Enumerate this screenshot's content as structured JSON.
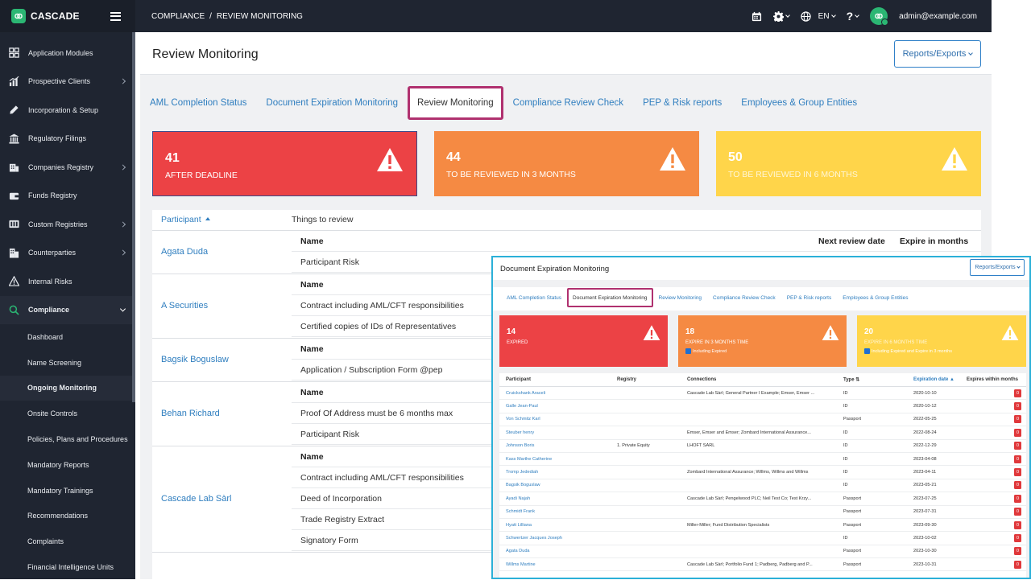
{
  "app": {
    "name": "CASCADE"
  },
  "topbar": {
    "breadcrumb": [
      "COMPLIANCE",
      "/",
      "REVIEW MONITORING"
    ],
    "language": "EN",
    "user": "admin@example.com"
  },
  "sidebar": {
    "items": [
      {
        "label": "Application Modules",
        "icon": "grid-icon",
        "chevron": false
      },
      {
        "label": "Prospective Clients",
        "icon": "chart-icon",
        "chevron": true
      },
      {
        "label": "Incorporation & Setup",
        "icon": "pen-icon",
        "chevron": false
      },
      {
        "label": "Regulatory Filings",
        "icon": "bank-icon",
        "chevron": false
      },
      {
        "label": "Companies Registry",
        "icon": "building-icon",
        "chevron": true
      },
      {
        "label": "Funds Registry",
        "icon": "wallet-icon",
        "chevron": false
      },
      {
        "label": "Custom Registries",
        "icon": "columns-icon",
        "chevron": true
      },
      {
        "label": "Counterparties",
        "icon": "office-icon",
        "chevron": true
      },
      {
        "label": "Internal Risks",
        "icon": "warning-icon",
        "chevron": false
      },
      {
        "label": "Compliance",
        "icon": "search-icon",
        "chevron": true,
        "active": true
      }
    ],
    "subitems": [
      {
        "label": "Dashboard"
      },
      {
        "label": "Name Screening"
      },
      {
        "label": "Ongoing Monitoring",
        "active": true
      },
      {
        "label": "Onsite Controls"
      },
      {
        "label": "Policies, Plans and Procedures"
      },
      {
        "label": "Mandatory Reports"
      },
      {
        "label": "Mandatory Trainings"
      },
      {
        "label": "Recommendations"
      },
      {
        "label": "Complaints"
      },
      {
        "label": "Financial Intelligence Units"
      }
    ]
  },
  "page": {
    "title": "Review Monitoring",
    "export_label": "Reports/Exports",
    "tabs": [
      "AML Completion Status",
      "Document Expiration Monitoring",
      "Review Monitoring",
      "Compliance Review Check",
      "PEP & Risk reports",
      "Employees & Group Entities"
    ],
    "active_tab": 2,
    "cards": [
      {
        "number": "41",
        "label": "AFTER DEADLINE",
        "color": "#ec4245"
      },
      {
        "number": "44",
        "label": "TO BE REVIEWED IN 3 MONTHS",
        "color": "#f58a43"
      },
      {
        "number": "50",
        "label": "TO BE REVIEWED IN 6 MONTHS",
        "color": "#ffd54a"
      }
    ],
    "table": {
      "col_participant": "Participant",
      "col_things": "Things to review",
      "sub_name": "Name",
      "sub_next": "Next review date",
      "sub_expire": "Expire in months",
      "groups": [
        {
          "participant": "Agata Duda",
          "items": [
            "Participant Risk"
          ],
          "show_extra_headers": true
        },
        {
          "participant": "A Securities",
          "items": [
            "Contract including AML/CFT responsibilities",
            "Certified copies of IDs of Representatives"
          ]
        },
        {
          "participant": "Bagsik Boguslaw",
          "items": [
            "Application / Subscription Form @pep"
          ]
        },
        {
          "participant": "Behan Richard",
          "items": [
            "Proof Of Address must be 6 months max",
            "Participant Risk"
          ]
        },
        {
          "participant": "Cascade Lab Sàrl",
          "items": [
            "Contract including AML/CFT responsibilities",
            "Deed of Incorporation",
            "Trade Registry Extract",
            "Signatory Form"
          ]
        }
      ]
    }
  },
  "overlay": {
    "title": "Document Expiration Monitoring",
    "export_label": "Reports/Exports",
    "tabs": [
      "AML Completion Status",
      "Document Expiration Monitoring",
      "Review Monitoring",
      "Compliance Review Check",
      "PEP & Risk reports",
      "Employees & Group Entities"
    ],
    "active_tab": 1,
    "cards": [
      {
        "number": "14",
        "label": "EXPIRED",
        "checkbox": ""
      },
      {
        "number": "18",
        "label": "EXPIRE IN 3 MONTHS TIME",
        "checkbox": "Including Expired"
      },
      {
        "number": "20",
        "label": "EXPIRE IN 6 MONTHS TIME",
        "checkbox": "Including Expired and Expire in 3 months"
      }
    ],
    "columns": [
      "Participant",
      "Registry",
      "Connections",
      "Type ⇅",
      "Expiration date ▲",
      "Expires within months"
    ],
    "rows": [
      {
        "participant": "Cruickshank Araceli",
        "registry": "",
        "connections": "Cascade Lab Sàrl; General Partner I Example; Emser, Emser ...",
        "type": "ID",
        "date": "2020-10-10",
        "badge": "0"
      },
      {
        "participant": "Galle Jean-Paul",
        "registry": "",
        "connections": "",
        "type": "ID",
        "date": "2020-10-12",
        "badge": "0"
      },
      {
        "participant": "Von Schmitz Karl",
        "registry": "",
        "connections": "",
        "type": "Passport",
        "date": "2022-05-25",
        "badge": "0"
      },
      {
        "participant": "Steuber henry",
        "registry": "",
        "connections": "Emser, Emser and Emser; Zombard International Assurance...",
        "type": "ID",
        "date": "2022-08-24",
        "badge": "0"
      },
      {
        "participant": "Johnson Boris",
        "registry": "1. Private Equity",
        "connections": "LHOFT SARL",
        "type": "ID",
        "date": "2022-12-29",
        "badge": "0"
      },
      {
        "participant": "Kass Marthe Catherine",
        "registry": "",
        "connections": "",
        "type": "ID",
        "date": "2023-04-08",
        "badge": "0"
      },
      {
        "participant": "Tromp Jedediah",
        "registry": "",
        "connections": "Zombard International Assurance; Willms, Willms and Willms",
        "type": "ID",
        "date": "2023-04-11",
        "badge": "0"
      },
      {
        "participant": "Bagsik Boguslaw",
        "registry": "",
        "connections": "",
        "type": "ID",
        "date": "2023-05-21",
        "badge": "0"
      },
      {
        "participant": "Ayadi Najah",
        "registry": "",
        "connections": "Cascade Lab Sàrl; Pengelwood PLC; Neil Test Co; Test Krzy...",
        "type": "Passport",
        "date": "2023-07-25",
        "badge": "0"
      },
      {
        "participant": "Schmidt Frank",
        "registry": "",
        "connections": "",
        "type": "Passport",
        "date": "2023-07-31",
        "badge": "0"
      },
      {
        "participant": "Hyatt Lilliana",
        "registry": "",
        "connections": "Miller-Miller; Fund Distribution Specialists",
        "type": "Passport",
        "date": "2023-09-30",
        "badge": "0"
      },
      {
        "participant": "Schwertzer Jacques Joseph",
        "registry": "",
        "connections": "",
        "type": "ID",
        "date": "2023-10-02",
        "badge": "0"
      },
      {
        "participant": "Agata Duda",
        "registry": "",
        "connections": "",
        "type": "Passport",
        "date": "2023-10-30",
        "badge": "0"
      },
      {
        "participant": "Willms Martine",
        "registry": "",
        "connections": "Cascade Lab Sàrl; Portfolio Fund 1; Padberg, Padberg and P...",
        "type": "Passport",
        "date": "2023-10-31",
        "badge": "0"
      }
    ]
  }
}
